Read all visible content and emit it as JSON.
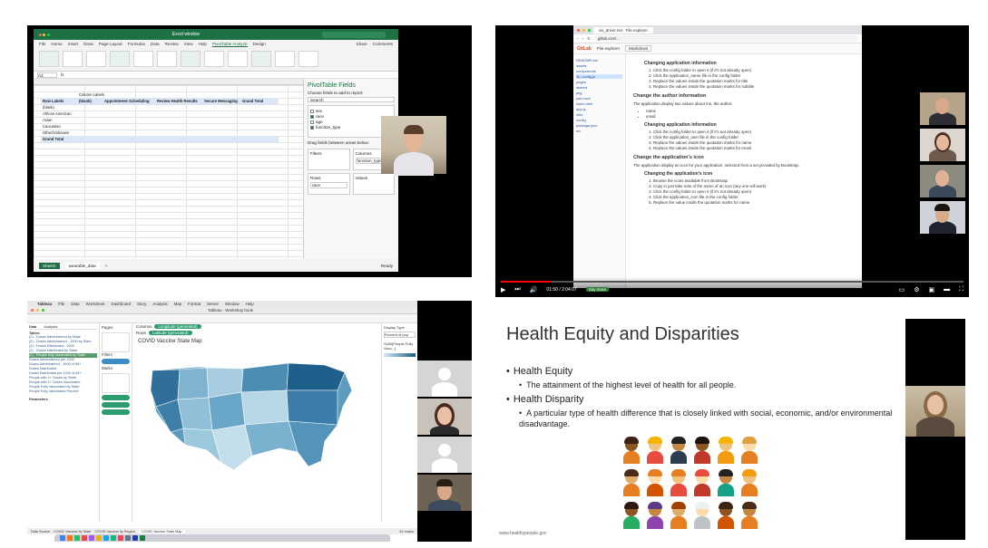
{
  "excel": {
    "app_title": "Excel window",
    "search_placeholder": "Search",
    "menu": [
      "File",
      "Home",
      "Insert",
      "Draw",
      "Page Layout",
      "Formulas",
      "Data",
      "Review",
      "View",
      "Help",
      "PivotTable Analyze",
      "Design"
    ],
    "share_label": "Share",
    "comments_label": "Comments",
    "name_box": "A3",
    "pivot": {
      "header_row_labels": "Row Labels",
      "header_column_labels": "Column Labels",
      "header_cols": [
        "(blank)",
        "Appointment Scheduling",
        "Review Health Results",
        "Secure Messaging",
        "Grand Total"
      ],
      "rows": [
        "(blank)",
        "African American",
        "Asian",
        "Caucasian",
        "Other/Unknown"
      ],
      "grand_total": "Grand Total"
    },
    "fields_pane": {
      "title": "PivotTable Fields",
      "subtitle": "Choose fields to add to report:",
      "search_placeholder": "Search",
      "fields": [
        "sex",
        "race",
        "age",
        "function_type"
      ],
      "drag_label": "Drag fields between areas below:",
      "filters_label": "Filters",
      "columns_label": "Columns",
      "rows_label": "Rows",
      "values_label": "Values",
      "columns_value": "function_type",
      "rows_value": "race"
    },
    "sheet_tabs": [
      "Sheet1",
      "wearable_data"
    ],
    "active_sheet": "Sheet1",
    "status": "Ready"
  },
  "gitlab": {
    "tab_title": "vis_driver.md · File explorer",
    "url": "gitlab.com/...",
    "brand": "GitLab",
    "project_label": "File explorer",
    "branch": "Markdown",
    "sidebar_items": [
      "README.md",
      "assets",
      "components",
      "lib_config.js",
      "pages",
      "shared",
      "pkg",
      "yarn.lock",
      "index.html",
      "app.js",
      "utils",
      "config",
      "package.json",
      "src"
    ],
    "sections": [
      {
        "h3": "",
        "h4": "Changing application information",
        "steps": [
          "Click the config folder to open it (if it's not already open)",
          "Click the application_name file in the config folder",
          "Replace the values inside the quotation marks for title",
          "Replace the values inside the quotation marks for subtitle"
        ]
      },
      {
        "h3": "Change the author information",
        "p": "The application display two values about me, the author.",
        "bullets": [
          "name",
          "email"
        ],
        "h4": "Changing application information",
        "steps": [
          "Click the config folder to open it (if it's not already open)",
          "Click the application_user file in the config folder",
          "Replace the values inside the quotation marks for name",
          "Replace the values inside the quotation marks for email"
        ]
      },
      {
        "h3": "Change the application's icon",
        "p": "The application display an icon for your application, selected from a set provided by Bootstrap.",
        "h4": "Changing the application's icon",
        "steps": [
          "Browse the icons available from Bootstrap",
          "Copy in just take note of the name of an icon (any one will work)",
          "Click the config folder to open it (if it's not already open)",
          "Click the application_icon file in the config folder",
          "Replace the value inside the quotation marks for name"
        ]
      }
    ],
    "video_time": "01:50 / 2:04:07",
    "chip": "Say more"
  },
  "tableau": {
    "menubar": [
      "Tableau",
      "File",
      "Data",
      "Worksheet",
      "Dashboard",
      "Story",
      "Analysis",
      "Map",
      "Format",
      "Server",
      "Window",
      "Help"
    ],
    "window_title": "Tableau - Workshop book",
    "data_tab": "Data",
    "analytics_tab": "Analytics",
    "tables_label": "Tables",
    "table_rows": [
      "(2) - Doses Administered by State",
      "(2) - Doses Administered - 1000 by State",
      "(2) - Doses Distributed - 1000",
      "(2) - Doses Distributed by State",
      "(2) - People fully vaccinated by State",
      "Doses Administered per 1000",
      "Doses Administered - 1000 of 65+",
      "Doses Distributed",
      "Doses Distributed per 1000 of 65+",
      "People with 1+ Doses by State",
      "People with 1+ Doses Vaccinated",
      "People Fully Vaccinated by State",
      "People Fully Vaccinated Percent"
    ],
    "parameters_label": "Parameters",
    "pages_label": "Pages",
    "filters_label": "Filters",
    "marks_label": "Marks",
    "columns_label": "Columns",
    "rows_label": "Rows",
    "columns_pill": "Longitude (generated)",
    "rows_pill": "Latitude (generated)",
    "view_title": "COVID Vaccine State Map",
    "legend_title": "Display Type",
    "legend_value": "Percent of pop.",
    "legend_measure": "SUM(People Fully Vacc...)",
    "sheet_tabs": [
      "Data Source",
      "COVID Vaccine by State",
      "COVID Vaccine by Region",
      "COVID Vaccine State Map"
    ],
    "active_tab": "COVID Vaccine State Map",
    "status_marks": "51 marks"
  },
  "slide": {
    "title": "Health Equity and Disparities",
    "bullets": [
      {
        "label": "Health Equity",
        "sub": "The attainment of the highest level of health for all people."
      },
      {
        "label": "Health Disparity",
        "sub": "A particular type of health difference that is closely linked with social, economic, and/or environmental disadvantage."
      }
    ],
    "footer": "www.healthypeople.gov"
  }
}
